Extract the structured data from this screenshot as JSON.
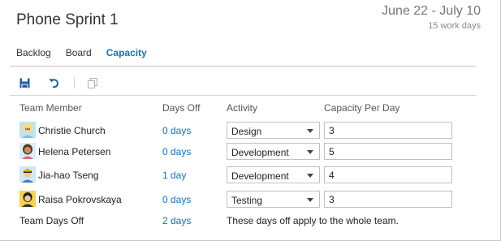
{
  "header": {
    "title": "Phone Sprint 1",
    "date_range": "June 22 - July 10",
    "work_days": "15 work days"
  },
  "tabs": [
    {
      "label": "Backlog",
      "active": false
    },
    {
      "label": "Board",
      "active": false
    },
    {
      "label": "Capacity",
      "active": true
    }
  ],
  "toolbar": {
    "save_icon": "save-icon",
    "undo_icon": "undo-icon",
    "copy_icon": "copy-icon"
  },
  "columns": {
    "member": "Team Member",
    "days_off": "Days Off",
    "activity": "Activity",
    "capacity": "Capacity Per Day"
  },
  "members": [
    {
      "name": "Christie Church",
      "days_off": "0 days",
      "activity": "Design",
      "capacity": "3"
    },
    {
      "name": "Helena Petersen",
      "days_off": "0 days",
      "activity": "Development",
      "capacity": "5"
    },
    {
      "name": "Jia-hao Tseng",
      "days_off": "1 day",
      "activity": "Development",
      "capacity": "4"
    },
    {
      "name": "Raisa Pokrovskaya",
      "days_off": "0 days",
      "activity": "Testing",
      "capacity": "3"
    }
  ],
  "footer": {
    "label": "Team Days Off",
    "days_off": "2 days",
    "note": "These days off apply to the whole team."
  },
  "colors": {
    "accent": "#0f73c4",
    "border": "#c8c8c8"
  }
}
